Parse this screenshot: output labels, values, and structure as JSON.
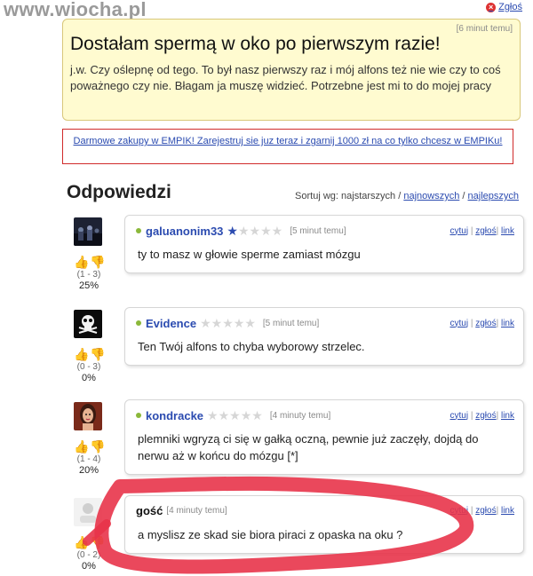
{
  "site": {
    "watermark": "www.wiocha.pl"
  },
  "top": {
    "report_label": "Zgłoś"
  },
  "question": {
    "time": "[6 minut temu]",
    "title": "Dostałam spermą w oko po pierwszym razie!",
    "body": "j.w. Czy oślepnę od tego. To był nasz pierwszy raz i mój alfons też nie wie czy to coś poważnego czy nie. Błagam ja muszę widzieć. Potrzebne jest mi to do mojej pracy"
  },
  "ad": {
    "text": "Darmowe zakupy w EMPIK! Zarejestruj sie juz teraz i zgarnij 1000 zł na co tylko chcesz w EMPIKu!"
  },
  "answers_header": {
    "title": "Odpowiedzi",
    "sort_label": "Sortuj wg:",
    "sort_current": "najstarszych",
    "sort_sep": "/",
    "sort_newest": "najnowszych",
    "sort_best": "najlepszych"
  },
  "actions": {
    "quote": "cytuj",
    "report": "zgłoś",
    "link": "link",
    "sep": "|"
  },
  "answers": [
    {
      "author": "galuanonim33",
      "stars_filled": 1,
      "time": "[5 minut temu]",
      "text": "ty to masz w głowie sperme zamiast mózgu",
      "votes": "(1 - 3)",
      "percent": "25%",
      "avatar": "dark-crowd-avatar"
    },
    {
      "author": "Evidence",
      "stars_filled": 0,
      "time": "[5 minut temu]",
      "text": "Ten Twój alfons to chyba wyborowy strzelec.",
      "votes": "(0 - 3)",
      "percent": "0%",
      "avatar": "skull-avatar"
    },
    {
      "author": "kondracke",
      "stars_filled": 0,
      "time": "[4 minuty temu]",
      "text": "plemniki wgryzą ci się w gałką oczną, pewnie już zaczęły, dojdą do nerwu aż w końcu do mózgu [*]",
      "votes": "(1 - 4)",
      "percent": "20%",
      "avatar": "woman-portrait-avatar"
    },
    {
      "author": "gość",
      "stars_filled": null,
      "time": "[4 minuty temu]",
      "text": "a myslisz ze skad sie biora piraci z opaska na oku ?",
      "votes": "(0 - 2)",
      "percent": "0%",
      "avatar": "guest-placeholder-avatar"
    }
  ],
  "colors": {
    "link": "#2b4bb0",
    "question_bg": "#fffbd0",
    "ad_border": "#d02a2a",
    "scribble": "#e8344a"
  },
  "icons": {
    "up": "thumb-up-icon",
    "down": "thumb-down-icon",
    "star": "star-icon",
    "report": "close-circle-icon"
  }
}
